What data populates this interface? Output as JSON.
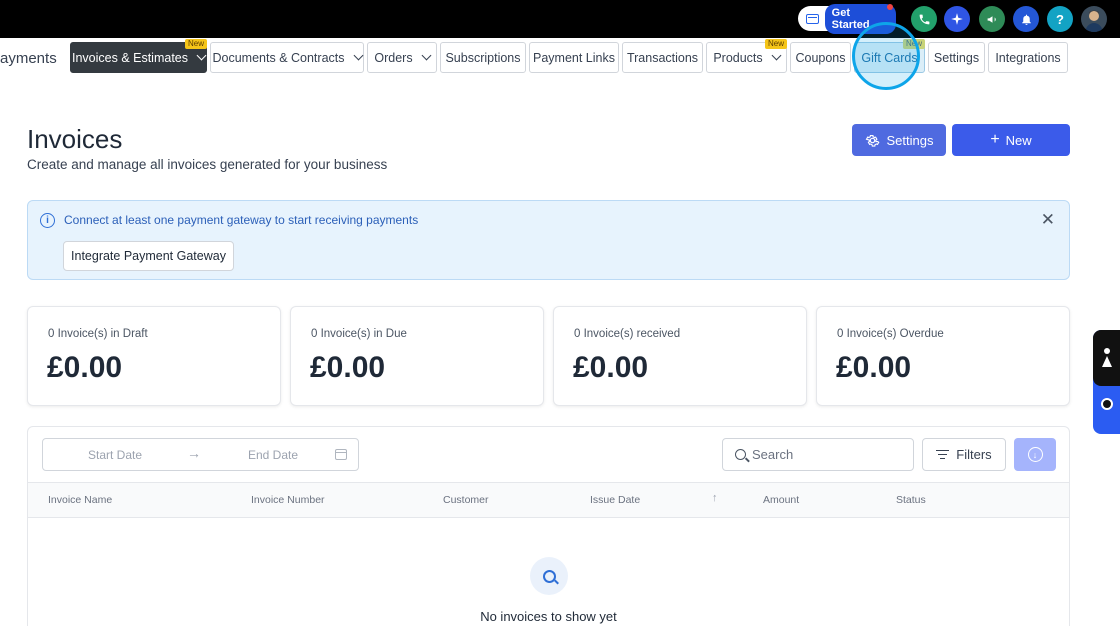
{
  "topbar": {
    "get_started_label": "Get Started",
    "icons": [
      "phone-icon",
      "sparkle-icon",
      "megaphone-icon",
      "bell-icon",
      "help-icon",
      "avatar"
    ],
    "help_glyph": "?",
    "colors": {
      "phone": "#22a06b",
      "sparkle": "#2f55e4",
      "megaphone": "#2e8b57",
      "bell": "#2457d6",
      "help": "#13a3c4"
    }
  },
  "nav": {
    "prefix": "ayments",
    "tabs": [
      {
        "label": "Invoices & Estimates",
        "active": true,
        "dropdown": true,
        "badge": "New"
      },
      {
        "label": "Documents & Contracts",
        "dropdown": true
      },
      {
        "label": "Orders",
        "dropdown": true
      },
      {
        "label": "Subscriptions"
      },
      {
        "label": "Payment Links"
      },
      {
        "label": "Transactions"
      },
      {
        "label": "Products",
        "dropdown": true,
        "badge": "New"
      },
      {
        "label": "Coupons"
      },
      {
        "label": "Gift Cards",
        "badge": "New"
      },
      {
        "label": "Settings"
      },
      {
        "label": "Integrations"
      }
    ]
  },
  "header": {
    "title": "Invoices",
    "subtitle": "Create and manage all invoices generated for your business",
    "settings_label": "Settings",
    "new_label": "New",
    "new_glyph": "+"
  },
  "alert": {
    "message": "Connect at least one payment gateway to start receiving payments",
    "button_label": "Integrate Payment Gateway",
    "info_glyph": "i",
    "close_glyph": "✕"
  },
  "stats": [
    {
      "label": "0 Invoice(s) in Draft",
      "value": "£0.00"
    },
    {
      "label": "0 Invoice(s) in Due",
      "value": "£0.00"
    },
    {
      "label": "0 Invoice(s) received",
      "value": "£0.00"
    },
    {
      "label": "0 Invoice(s) Overdue",
      "value": "£0.00"
    }
  ],
  "table": {
    "start_date_placeholder": "Start Date",
    "end_date_placeholder": "End Date",
    "arrow_glyph": "→",
    "search_placeholder": "Search",
    "filters_label": "Filters",
    "download_glyph": "↓",
    "sort_glyph": "↑",
    "columns": [
      "Invoice Name",
      "Invoice Number",
      "Customer",
      "Issue Date",
      "Amount",
      "Status"
    ],
    "empty_message": "No invoices to show yet"
  }
}
